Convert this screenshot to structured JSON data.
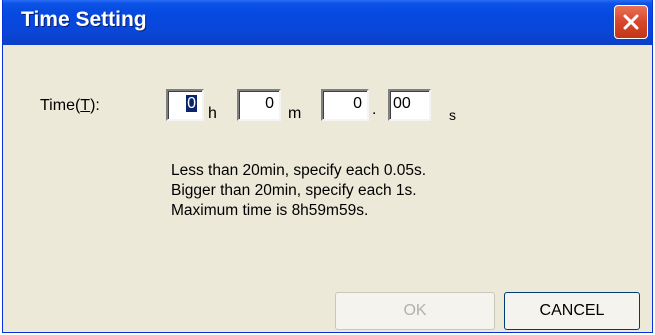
{
  "window": {
    "title": "Time Setting",
    "close_icon": "close-icon"
  },
  "form": {
    "time_label_prefix": "Time(",
    "time_label_accel": "T",
    "time_label_suffix": "):",
    "hours_value": "0",
    "minutes_value": "0",
    "seconds_value": "0",
    "fraction_value": "00",
    "unit_hours": "h",
    "unit_minutes": "m",
    "unit_decimal": ".",
    "unit_seconds": "s"
  },
  "info": {
    "line1": "Less than 20min, specify each 0.05s.",
    "line2": "Bigger than 20min, specify each 1s.",
    "line3": "Maximum time is 8h59m59s."
  },
  "buttons": {
    "ok_label": "OK",
    "cancel_label": "CANCEL"
  },
  "colors": {
    "title_bar": "#0a52e6",
    "dialog_bg": "#ece9d8",
    "selection": "#0a246a",
    "close_button": "#d9462b"
  }
}
